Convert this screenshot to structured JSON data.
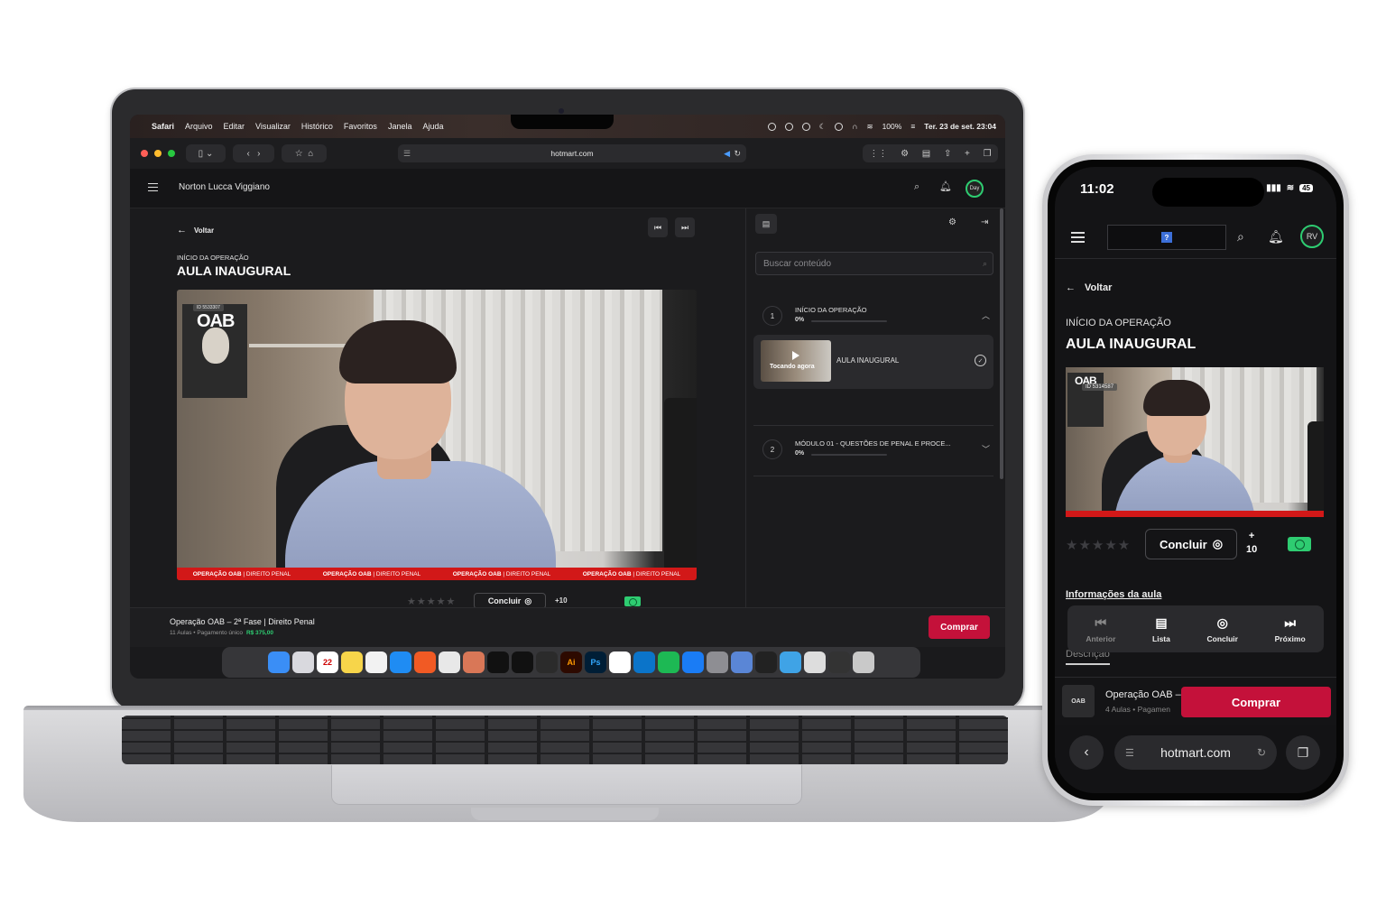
{
  "laptop": {
    "menubar": {
      "items": [
        "Safari",
        "Arquivo",
        "Editar",
        "Visualizar",
        "Histórico",
        "Favoritos",
        "Janela",
        "Ajuda"
      ],
      "battery": "100%",
      "datetime": "Ter. 23 de set. 23:04"
    },
    "browser": {
      "url": "hotmart.com"
    },
    "header": {
      "user_name": "Norton Lucca Viggiano",
      "avatar": "Day"
    },
    "main": {
      "back_label": "Voltar",
      "module_label": "INÍCIO DA OPERAÇÃO",
      "lesson_title": "AULA INAUGURAL",
      "video": {
        "logo": "OAB",
        "id_badge": "ID 5533307",
        "ticker": [
          "OPERAÇÃO OAB",
          "| DIREITO PENAL"
        ]
      },
      "rating_stars": 5,
      "concluir_label": "Concluir",
      "points": "+10"
    },
    "side": {
      "search_placeholder": "Buscar conteúdo",
      "modules": [
        {
          "number": "1",
          "title": "INÍCIO DA OPERAÇÃO",
          "progress": "0%"
        },
        {
          "number": "2",
          "title": "MÓDULO 01 - QUESTÕES DE PENAL E PROCE...",
          "progress": "0%"
        }
      ],
      "lesson": {
        "now_playing": "Tocando agora",
        "title": "AULA INAUGURAL"
      }
    },
    "bottom": {
      "course_name": "Operação OAB – 2ª Fase | Direito Penal",
      "course_sub": "11 Aulas • Pagamento único",
      "price": "R$ 375,00",
      "buy_label": "Comprar"
    },
    "dock": [
      "Finder",
      "Launchpad",
      "22",
      "Notes",
      "Reminders",
      "Safari",
      "Brave",
      "ChatGPT",
      "Claude",
      "Notion AI",
      "CapCut",
      "Figma",
      "Ai",
      "Ps",
      "Notion",
      "VS Code",
      "Spotify",
      "App Store",
      "Settings",
      "Preview",
      "iPhone",
      "Folder",
      "Docs",
      "Screens",
      "Trash"
    ]
  },
  "phone": {
    "time": "11:02",
    "battery": "45",
    "avatar": "RV",
    "back_label": "Voltar",
    "module_label": "INÍCIO DA OPERAÇÃO",
    "lesson_title": "AULA INAUGURAL",
    "video": {
      "logo": "OAB",
      "id_badge": "ID 5314587"
    },
    "concluir_label": "Concluir",
    "points_plus": "+",
    "points_value": "10",
    "info_label": "Informações da aula",
    "tabs": [
      {
        "label": "Anterior",
        "icon": "skip-back-icon"
      },
      {
        "label": "Lista",
        "icon": "list-icon"
      },
      {
        "label": "Concluir",
        "icon": "check-circle-icon"
      },
      {
        "label": "Próximo",
        "icon": "skip-forward-icon"
      }
    ],
    "description_tab": "Descrição",
    "course_thumb": "OAB",
    "course_name": "Operação OAB –",
    "course_sub": "4 Aulas • Pagamen",
    "buy_label": "Comprar",
    "url": "hotmart.com"
  },
  "colors": {
    "accent_buy": "#c4113a",
    "progress_green": "#2ecc71",
    "ticker_red": "#d21818"
  }
}
